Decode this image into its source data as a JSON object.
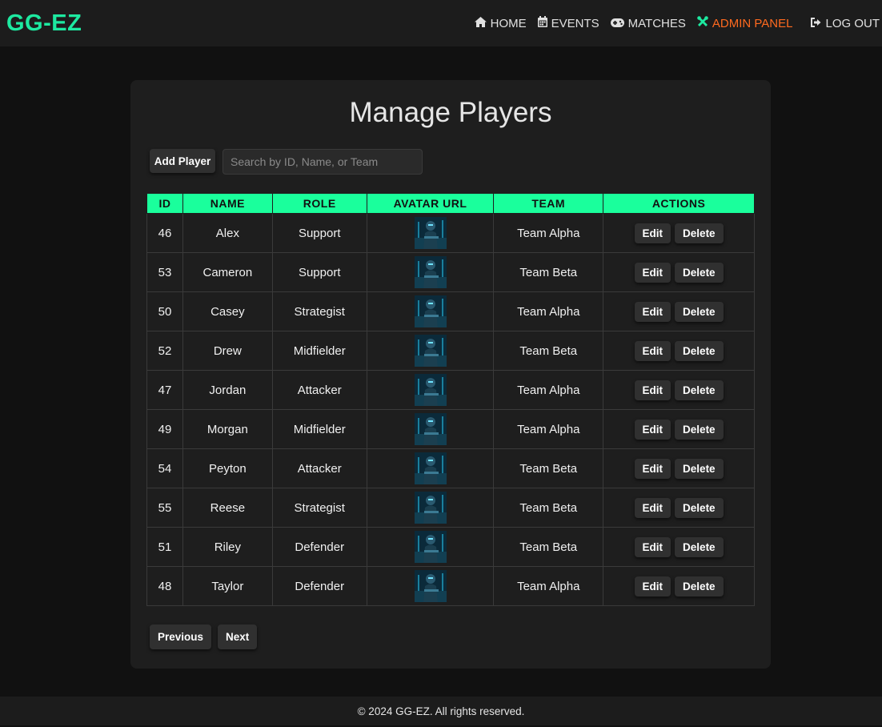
{
  "app": {
    "logo": "GG-EZ"
  },
  "nav": [
    {
      "label": "HOME",
      "icon": "home-icon"
    },
    {
      "label": "EVENTS",
      "icon": "calendar-icon"
    },
    {
      "label": "MATCHES",
      "icon": "gamepad-icon"
    },
    {
      "label": "ADMIN PANEL",
      "icon": "tools-icon"
    },
    {
      "label": "LOG OUT",
      "icon": "logout-icon"
    }
  ],
  "colors": {
    "accent": "#1aff9c",
    "admin": "#ff6a1f",
    "background": "#111111",
    "card": "#1e1e1e"
  },
  "page": {
    "title": "Manage Players",
    "add_label": "Add Player",
    "search_placeholder": "Search by ID, Name, or Team"
  },
  "table": {
    "headers": [
      "ID",
      "NAME",
      "ROLE",
      "AVATAR URL",
      "TEAM",
      "ACTIONS"
    ],
    "edit_label": "Edit",
    "delete_label": "Delete",
    "rows": [
      {
        "id": "46",
        "name": "Alex",
        "role": "Support",
        "team": "Team Alpha"
      },
      {
        "id": "53",
        "name": "Cameron",
        "role": "Support",
        "team": "Team Beta"
      },
      {
        "id": "50",
        "name": "Casey",
        "role": "Strategist",
        "team": "Team Alpha"
      },
      {
        "id": "52",
        "name": "Drew",
        "role": "Midfielder",
        "team": "Team Beta"
      },
      {
        "id": "47",
        "name": "Jordan",
        "role": "Attacker",
        "team": "Team Alpha"
      },
      {
        "id": "49",
        "name": "Morgan",
        "role": "Midfielder",
        "team": "Team Alpha"
      },
      {
        "id": "54",
        "name": "Peyton",
        "role": "Attacker",
        "team": "Team Beta"
      },
      {
        "id": "55",
        "name": "Reese",
        "role": "Strategist",
        "team": "Team Beta"
      },
      {
        "id": "51",
        "name": "Riley",
        "role": "Defender",
        "team": "Team Beta"
      },
      {
        "id": "48",
        "name": "Taylor",
        "role": "Defender",
        "team": "Team Alpha"
      }
    ]
  },
  "pagination": {
    "previous_label": "Previous",
    "next_label": "Next"
  },
  "footer": {
    "text": "© 2024 GG-EZ. All rights reserved."
  }
}
